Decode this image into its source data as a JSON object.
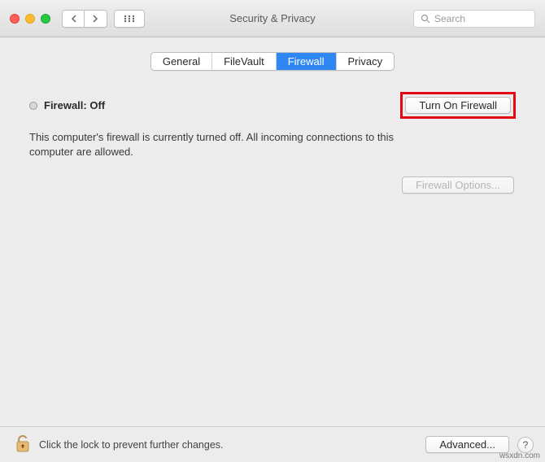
{
  "window": {
    "title": "Security & Privacy"
  },
  "search": {
    "placeholder": "Search"
  },
  "tabs": [
    {
      "label": "General",
      "active": false
    },
    {
      "label": "FileVault",
      "active": false
    },
    {
      "label": "Firewall",
      "active": true
    },
    {
      "label": "Privacy",
      "active": false
    }
  ],
  "firewall": {
    "status_label": "Firewall: Off",
    "turn_on_button": "Turn On Firewall",
    "description": "This computer's firewall is currently turned off. All incoming connections to this computer are allowed.",
    "options_button": "Firewall Options...",
    "options_enabled": false
  },
  "footer": {
    "lock_text": "Click the lock to prevent further changes.",
    "advanced_button": "Advanced...",
    "help_label": "?"
  },
  "colors": {
    "highlight_red": "#e30613",
    "tab_active_blue": "#2f87f3"
  },
  "watermark": "wsxdn.com"
}
